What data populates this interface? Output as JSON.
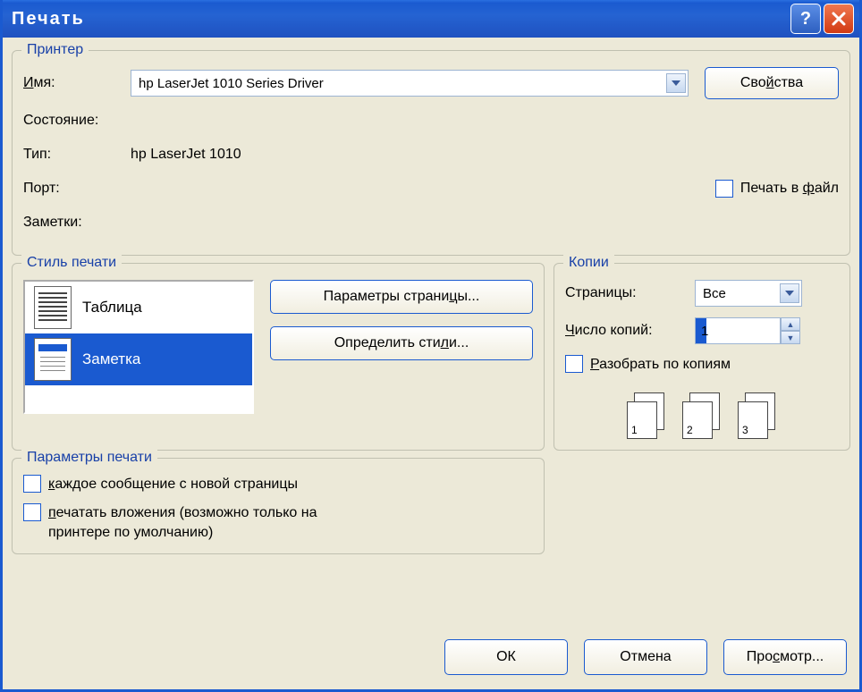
{
  "title": "Печать",
  "printer": {
    "legend": "Принтер",
    "name_label": "Имя:",
    "name_value": "hp LaserJet 1010 Series Driver",
    "properties_button": "Свойства",
    "status_label": "Состояние:",
    "status_value": "",
    "type_label": "Тип:",
    "type_value": "hp LaserJet 1010",
    "port_label": "Порт:",
    "port_value": "",
    "comments_label": "Заметки:",
    "comments_value": "",
    "print_to_file_label": "Печать в файл"
  },
  "styles": {
    "legend": "Стиль печати",
    "items": [
      "Таблица",
      "Заметка"
    ],
    "page_setup_button": "Параметры страницы...",
    "define_styles_button": "Определить стили..."
  },
  "copies": {
    "legend": "Копии",
    "pages_label": "Страницы:",
    "pages_value": "Все",
    "count_label": "Число копий:",
    "count_value": "1",
    "collate_label": "Разобрать по копиям",
    "stack_numbers": [
      "1",
      "2",
      "3"
    ]
  },
  "params": {
    "legend": "Параметры печати",
    "new_page_label": "каждое сообщение с новой страницы",
    "attachments_label": "печатать вложения (возможно только на принтере по умолчанию)"
  },
  "footer": {
    "ok": "ОК",
    "cancel": "Отмена",
    "preview": "Просмотр..."
  }
}
